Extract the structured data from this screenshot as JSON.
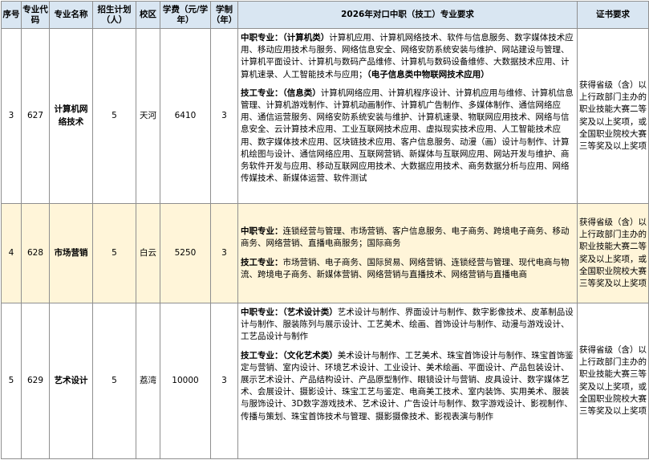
{
  "header": {
    "seq": "序号",
    "code": "专业代码",
    "name": "专业名称",
    "plan": "招生计划（人）",
    "campus": "校区",
    "fee": "学费（元/学年）",
    "years": "学制（年）",
    "req": "2026年对口中职（技工）专业要求",
    "cert": "证书要求"
  },
  "rows": [
    {
      "seq": "3",
      "code": "627",
      "name": "计算机网络技术",
      "plan": "5",
      "campus": "天河",
      "fee": "6410",
      "years": "3",
      "zhongzhi_label": "中职专业：",
      "zhongzhi_cat": "（计算机类）",
      "zhongzhi_text": "计算机应用、计算机网络技术、软件与信息服务、数字媒体技术应用、移动应用技术与服务、网络信息安全、网络安防系统安装与维护、网站建设与管理、计算机平面设计、计算机与数码产品维修、计算机与数码设备维修、大数据技术应用、计算机速录、人工智能技术与应用；",
      "zhongzhi_cat2": "（电子信息类中物联网技术应用）",
      "jigong_label": "技工专业：",
      "jigong_cat": "（信息类）",
      "jigong_text": "计算机网络应用、计算机程序设计、计算机应用与维修、计算机信息管理、计算机游戏制作、计算机动画制作、计算机广告制作、多媒体制作、通信网络应用、通信运营服务、网络安防系统安装与维护、计算机速录、物联网应用技术、网络与信息安全、云计算技术应用、工业互联网技术应用、虚拟现实技术应用、人工智能技术应用、数字媒体技术应用、区块链技术应用、客户信息服务、动漫（画）设计与制作、计算机绘图与设计、通信网络应用、互联网营销、新媒体与互联网应用、网站开发与维护、商务软件开发与应用、移动互联网应用技术、大数据应用技术、商务数据分析与应用、网络传媒技术、新媒体运营、软件测试",
      "cert_a": "获得省级（含）以上行政部门主办的职业技能大赛二等奖及以上奖项，或全国职业院校大赛三等奖及以上奖项"
    },
    {
      "seq": "4",
      "code": "628",
      "name": "市场营销",
      "plan": "5",
      "campus": "白云",
      "fee": "5250",
      "years": "3",
      "zhongzhi_label": "中职专业：",
      "zhongzhi_text": "连锁经营与管理、市场营销、客户信息服务、电子商务、跨境电子商务、移动商务、网络营销、直播电商服务；国际商务",
      "jigong_label": "技工专业：",
      "jigong_text": "市场营销、电子商务、国际贸易、网络营销、连锁经营与管理、现代电商与物流、跨境电子商务、新媒体营销、网络营销与直播技术、网络营销与直播电商",
      "cert_a": "获得省级（含）以上行政部门主办的职业技能大赛二等奖及以上奖项，或全国职业院校大赛三等奖及以上奖项"
    },
    {
      "seq": "5",
      "code": "629",
      "name": "艺术设计",
      "plan": "5",
      "campus": "荔湾",
      "fee": "10000",
      "years": "3",
      "zhongzhi_label": "中职专业：",
      "zhongzhi_cat": "（艺术设计类）",
      "zhongzhi_text": "艺术设计与制作、界面设计与制作、数字影像技术、皮革制品设计与制作、服装陈列与展示设计、工艺美术、绘画、首饰设计与制作、动漫与游戏设计、工艺品设计与制作",
      "jigong_label": "技工专业：",
      "jigong_cat": "（文化艺术类）",
      "jigong_text": "美术设计与制作、工艺美术、珠宝首饰设计与制作、珠宝首饰鉴定与营销、室内设计、环境艺术设计、工业设计、美术绘画、平面设计、产品包装设计、展示艺术设计、产品结构设计、产品原型制作、眼镜设计与营销、皮具设计、数字媒体艺术、会展设计、摄影设计、珠宝工艺与鉴定、电商美工技术、室内装饰、实用美术、服装与服饰设计、3D数字游戏技术、艺术设计、广告设计与制作、数字游戏设计、影视制作、传播与策划、珠宝首饰技术与管理、摄影摄像技术、影视表演与制作",
      "cert_a": "获得省级（含）以上行政部门主办的职业技能大赛三等奖及以上奖项，或全国职业院校大赛三等奖及以上奖项"
    }
  ]
}
